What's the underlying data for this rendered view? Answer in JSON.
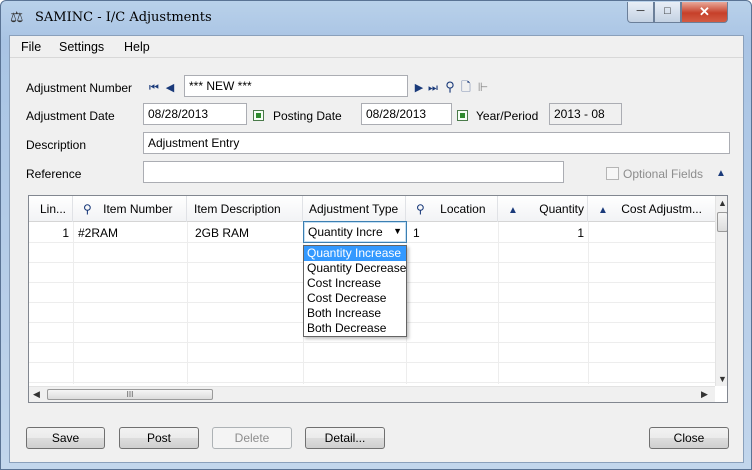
{
  "window": {
    "title": "SAMINC - I/C Adjustments",
    "app_icon": "scales-icon",
    "caption_buttons": {
      "minimize": "─",
      "maximize": "□",
      "close": "✕"
    }
  },
  "menu": {
    "file": "File",
    "settings": "Settings",
    "help": "Help"
  },
  "form": {
    "adjustment_number_label": "Adjustment Number",
    "adjustment_number_value": "*** NEW ***",
    "adjustment_date_label": "Adjustment Date",
    "adjustment_date_value": "08/28/2013",
    "posting_date_label": "Posting Date",
    "posting_date_value": "08/28/2013",
    "year_period_label": "Year/Period",
    "year_period_value": "2013 - 08",
    "description_label": "Description",
    "description_value": "Adjustment Entry",
    "reference_label": "Reference",
    "reference_value": "",
    "optional_fields_label": "Optional Fields"
  },
  "grid": {
    "columns": {
      "line": "Lin...",
      "item_number": "Item Number",
      "item_description": "Item Description",
      "adjustment_type": "Adjustment Type",
      "location": "Location",
      "quantity": "Quantity",
      "cost_adjustment": "Cost Adjustm..."
    },
    "rows": [
      {
        "line": "1",
        "item_number": "#2RAM",
        "item_description": "2GB RAM",
        "adjustment_type": "Quantity Incre",
        "location": "1",
        "quantity": "1",
        "cost_adjustment": ""
      }
    ],
    "hscroll_grip": "III"
  },
  "adjustment_type_dropdown": {
    "current": "Quantity Incre",
    "options": [
      "Quantity Increase",
      "Quantity Decrease",
      "Cost Increase",
      "Cost Decrease",
      "Both Increase",
      "Both Decrease"
    ],
    "selected_index": 0
  },
  "buttons": {
    "save": "Save",
    "post": "Post",
    "delete": "Delete",
    "detail": "Detail...",
    "close": "Close"
  }
}
